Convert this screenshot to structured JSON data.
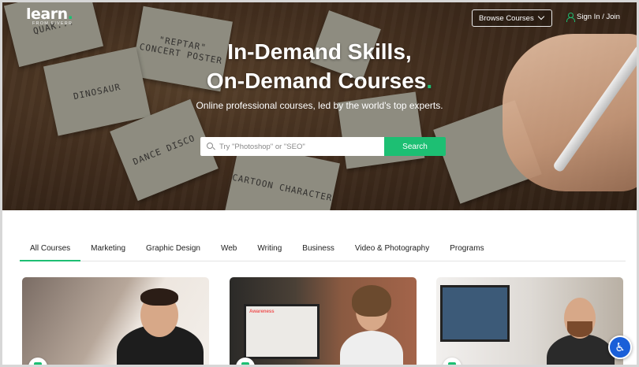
{
  "brand": {
    "logo_text": "learn",
    "logo_dot": ".",
    "logo_sub": "FROM FIVERR",
    "accent_color": "#1dbf73"
  },
  "header": {
    "browse_label": "Browse Courses",
    "signin_label": "Sign In / Join",
    "icons": {
      "browse": "chevron-down-icon",
      "signin": "user-icon"
    }
  },
  "hero": {
    "headline_line1": "In-Demand Skills,",
    "headline_line2": "On-Demand Courses",
    "headline_dot": ".",
    "subline": "Online professional courses, led by the world's top experts.",
    "search": {
      "placeholder": "Try \"Photoshop\" or \"SEO\"",
      "value": "",
      "button_label": "Search",
      "icon": "search-icon"
    }
  },
  "tabs": [
    {
      "label": "All Courses",
      "active": true
    },
    {
      "label": "Marketing",
      "active": false
    },
    {
      "label": "Graphic Design",
      "active": false
    },
    {
      "label": "Web",
      "active": false
    },
    {
      "label": "Writing",
      "active": false
    },
    {
      "label": "Business",
      "active": false
    },
    {
      "label": "Video & Photography",
      "active": false
    },
    {
      "label": "Programs",
      "active": false
    }
  ],
  "cards": [
    {
      "name": "course-card-1"
    },
    {
      "name": "course-card-2",
      "slide_title": "Awareness"
    },
    {
      "name": "course-card-3"
    }
  ],
  "accessibility": {
    "icon": "accessibility-icon",
    "glyph": "♿",
    "color": "#1a5fd8"
  }
}
